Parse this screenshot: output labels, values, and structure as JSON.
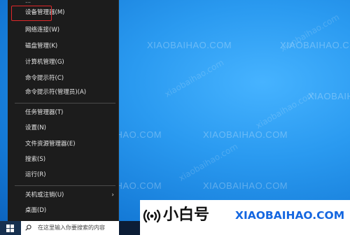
{
  "watermark": {
    "site": "XIAOBAIHAO.COM",
    "diagonal": "xiaobaihao.com"
  },
  "winx_menu": {
    "items": [
      {
        "label": "..."
      },
      {
        "label": "设备管理器(M)"
      },
      {
        "label": "网络连接(W)"
      },
      {
        "label": "磁盘管理(K)"
      },
      {
        "label": "计算机管理(G)"
      },
      {
        "label": "命令提示符(C)"
      },
      {
        "label": "命令提示符(管理员)(A)"
      },
      {
        "label": "任务管理器(T)"
      },
      {
        "label": "设置(N)"
      },
      {
        "label": "文件资源管理器(E)"
      },
      {
        "label": "搜索(S)"
      },
      {
        "label": "运行(R)"
      },
      {
        "label": "关机或注销(U)",
        "has_submenu": true,
        "submenu_arrow": "›"
      },
      {
        "label": "桌面(D)"
      }
    ],
    "highlighted_item": "设备管理器(M)",
    "highlight_color": "#e0282a"
  },
  "taskbar": {
    "search_placeholder": "在这里输入你要搜索的内容",
    "start_icon": "windows-logo-icon",
    "search_icon": "search-icon"
  },
  "brand": {
    "icon": "sound-wave-icon",
    "name_cn": "小白号",
    "domain": "XIAOBAIHAO.COM",
    "domain_color": "#1567e0"
  }
}
